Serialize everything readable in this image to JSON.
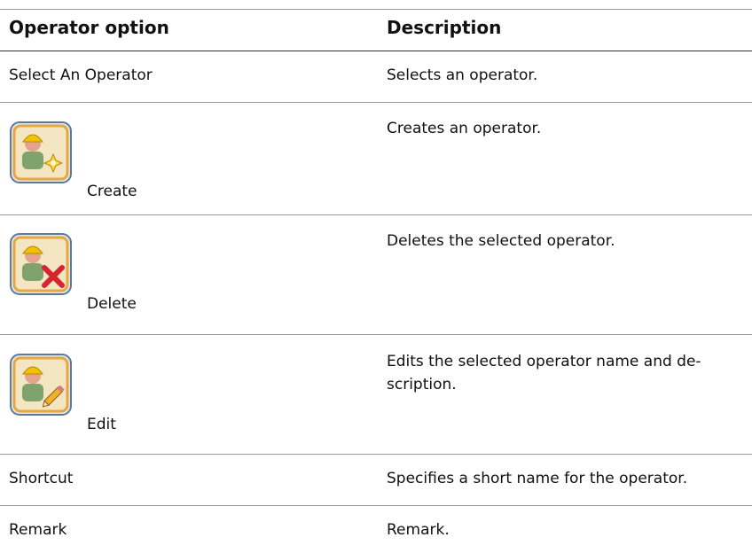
{
  "header": {
    "col1": "Operator option",
    "col2": "Description"
  },
  "rows": [
    {
      "option": "Select An Operator",
      "description": "Selects an operator.",
      "icon": null
    },
    {
      "option": "Create",
      "description": "Creates an operator.",
      "icon": "operator-create-icon"
    },
    {
      "option": "Delete",
      "description": "Deletes the selected operator.",
      "icon": "operator-delete-icon"
    },
    {
      "option": "Edit",
      "description": "Edits the selected operator name and de-\nscription.",
      "icon": "operator-edit-icon"
    },
    {
      "option": "Shortcut",
      "description": "Specifies a short name for the operator.",
      "icon": null
    },
    {
      "option": "Remark",
      "description": "Remark.",
      "icon": null
    }
  ],
  "colors": {
    "icon_frame": "#e8a640",
    "icon_bg": "#f4e6c2",
    "helmet": "#f2c200",
    "delete_x": "#d8242c"
  }
}
